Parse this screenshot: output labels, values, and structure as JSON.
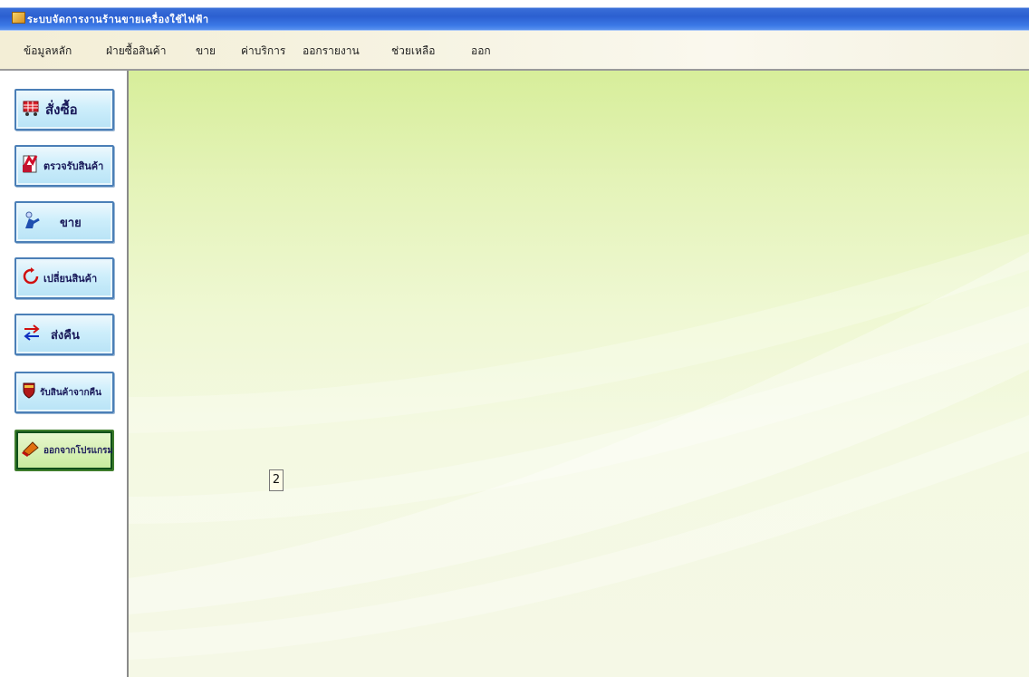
{
  "window": {
    "title": "ระบบจัดการงานร้านขายเครื่องใช้ไฟฟ้า"
  },
  "menu": [
    {
      "label": "ข้อมูลหลัก"
    },
    {
      "label": "ฝ่ายซื้อสินค้า"
    },
    {
      "label": "ขาย"
    },
    {
      "label": "ค่าบริการ"
    },
    {
      "label": "ออกรายงาน"
    },
    {
      "label": "ช่วยเหลือ"
    },
    {
      "label": "ออก"
    }
  ],
  "sidebar": {
    "buttons": [
      {
        "label": "สั่งซื้อ",
        "icon": "cart-icon"
      },
      {
        "label": "ตรวจรับสินค้า",
        "icon": "checklist-icon"
      },
      {
        "label": "ขาย",
        "icon": "person-icon"
      },
      {
        "label": "เปลี่ยนสินค้า",
        "icon": "refresh-icon"
      },
      {
        "label": "ส่งคืน",
        "icon": "swap-arrows-icon"
      },
      {
        "label": "รับสินค้าจากคืน",
        "icon": "shield-icon"
      },
      {
        "label": "ออกจากโปรแกรม",
        "icon": "exit-icon"
      }
    ]
  },
  "content": {
    "page_indicator": "2"
  },
  "colors": {
    "title_bar": "#2b5fd0",
    "button_face": "#cdeefb",
    "button_border": "#4b7fb7",
    "content_bg": "#e4f3b8"
  }
}
